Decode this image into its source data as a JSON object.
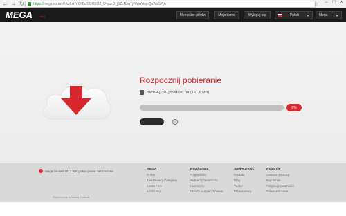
{
  "browser": {
    "back_icon": "←",
    "forward_icon": "→",
    "reload_icon": "↻",
    "url_secure": "https://",
    "url_rest": "mega.co.nz/#!Ao9xhYKYBc!5OM5OZ_U-uazO_j6ZcR5qYjvWeWtsjoQpWaSPtA",
    "star_icon": "☆"
  },
  "header": {
    "logo": "MEGA",
    "beta": "BETA",
    "buttons": [
      {
        "label": "Menedżer plików"
      },
      {
        "label": "Moje konto"
      },
      {
        "label": "Wyloguj się"
      },
      {
        "label": "Polski"
      },
      {
        "label": "Menu"
      }
    ]
  },
  "download": {
    "title": "Rozpocznij pobieranie",
    "file_name": "BWBIA[1x01]mvidasd.rar (127.6 MB)",
    "progress_percent": 0,
    "progress_label": "0%",
    "info_icon": "i"
  },
  "footer": {
    "copyright": "Mega Limited 2013 Wszystkie prawa zastrzeżone",
    "made_in": "Wytworzone w Nowej Zelandii",
    "columns": [
      {
        "heading": "MEGA",
        "links": [
          "O nas",
          "The Privacy Company",
          "Konto Free",
          "Konto Pro"
        ]
      },
      {
        "heading": "Współpraca",
        "links": [
          "Programiści",
          "Partnerzy techniczni",
          "Inwestorzy",
          "Zasady bezpieczeństwa"
        ]
      },
      {
        "heading": "Społeczność",
        "links": [
          "Kontakt",
          "Blog",
          "Twitter",
          "Przewodnicy"
        ]
      },
      {
        "heading": "Wsparcie",
        "links": [
          "Centrum pomocy",
          "Regulamin",
          "Polityka prywatności",
          "Prawa autorskie"
        ]
      }
    ]
  },
  "colors": {
    "accent": "#d9272e",
    "header_bg": "#1a1a1a",
    "footer_bg": "#d9d9d9"
  }
}
